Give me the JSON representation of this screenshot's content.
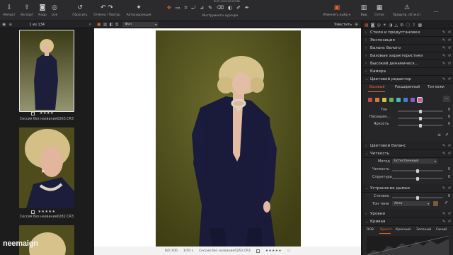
{
  "window": {
    "title": "Test.cosessiondb"
  },
  "toolbar": {
    "buttons": [
      {
        "label": "Импорт",
        "icon": "import-icon"
      },
      {
        "label": "Экспорт",
        "icon": "export-icon"
      },
      {
        "label": "Кадр",
        "icon": "camera-icon"
      },
      {
        "label": "Live",
        "icon": "live-icon"
      },
      {
        "label": "Сбросить",
        "icon": "reset-icon"
      },
      {
        "label": "Отмена / Повтор",
        "icon": "undo-redo-icon"
      },
      {
        "label": "Автокоррекция",
        "icon": "auto-adjust-icon"
      }
    ],
    "cursor_tools_label": "Инструменты курсора",
    "right_buttons": [
      {
        "label": "Изменить выбр-е",
        "icon": "edit-selection-icon"
      },
      {
        "label": "Вид",
        "icon": "view-icon"
      },
      {
        "label": "Сетка",
        "icon": "grid-icon"
      },
      {
        "label": "Предупр. об эксп.",
        "icon": "exposure-warning-icon"
      }
    ]
  },
  "browser": {
    "counter": "1 из 134"
  },
  "viewer": {
    "zoom_select": "Фон",
    "fit_label": "Уместить"
  },
  "filmstrip": {
    "items": [
      {
        "name": "Сессия без названия0263.CR3",
        "stars": "★★★★"
      },
      {
        "name": "Сессия без названия0282.CR3",
        "stars": "★★★★★"
      },
      {
        "name": "",
        "stars": ""
      }
    ]
  },
  "footer": {
    "iso": "ISO 100",
    "shutter": "1/50 s",
    "filename": "Сессия без названия0263.CR3",
    "stars": "★★★★★"
  },
  "watermark": "neemaign",
  "panels": {
    "styles": "Стили и предустановки",
    "exposure": "Экспозиция",
    "white_balance": "Баланс белого",
    "basic": "Базовые характеристики",
    "hdr": "Высокий динамическ...",
    "camera": "Камера",
    "color_editor": "Цветовой редактор",
    "color_tabs": [
      "Базовый",
      "Расширенный",
      "Тон кожи"
    ],
    "color_sliders": [
      {
        "label": "Тон",
        "value": "0"
      },
      {
        "label": "Насыщен...",
        "value": "0"
      },
      {
        "label": "Яркость",
        "value": "0"
      }
    ],
    "color_balance": "Цветовой баланс",
    "clarity": "Четкость",
    "clarity_method_label": "Метод",
    "clarity_method": "Естественный",
    "clarity_sliders": [
      {
        "label": "Четкость",
        "value": "0"
      },
      {
        "label": "Структура",
        "value": "0"
      }
    ],
    "dehaze": "Устранение дымки",
    "dehaze_rows": [
      {
        "label": "Степень",
        "value": "0"
      }
    ],
    "shadow_tone_label": "Тон тени",
    "shadow_tone": "Авто",
    "levels": "Уровни",
    "curve": "Кривая",
    "curve_tabs": [
      "RGB",
      "Яркост.",
      "Красный",
      "Зеленый",
      "Синий"
    ]
  },
  "colors": {
    "accent": "#e06a2c",
    "swatches": [
      "#c84a4a",
      "#d47b3c",
      "#d0c04a",
      "#5eb55e",
      "#4ab8b8",
      "#4a7bd0",
      "#8a5ad0",
      "#c85aa8"
    ]
  }
}
